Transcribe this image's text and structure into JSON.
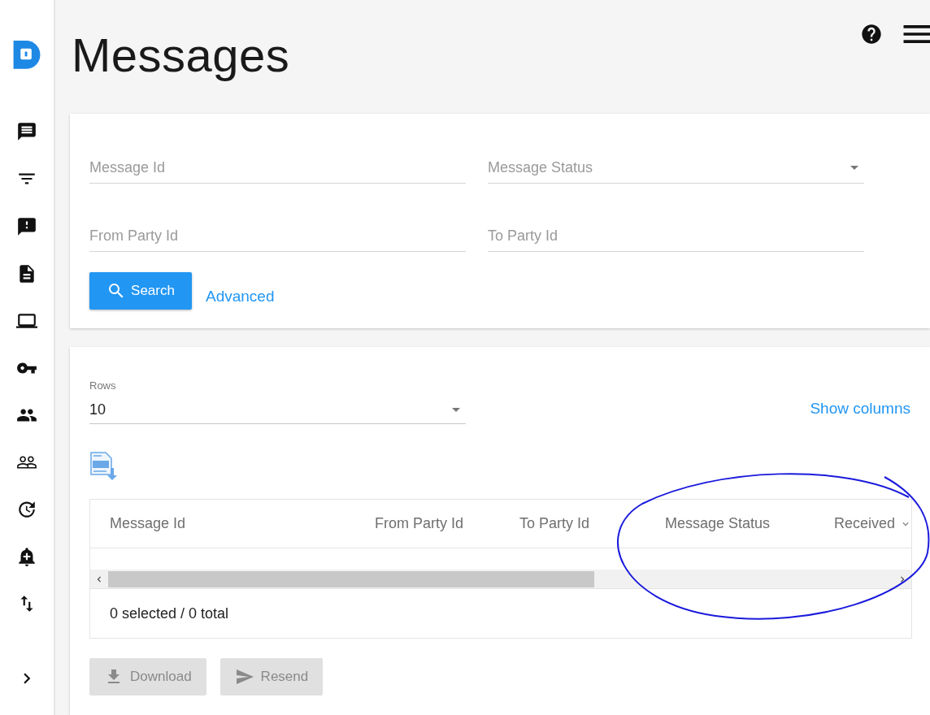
{
  "page": {
    "title": "Messages"
  },
  "filters": [
    {
      "kind": "text",
      "placeholder": "Message Id"
    },
    {
      "kind": "select",
      "placeholder": "Message Status"
    },
    {
      "kind": "text",
      "placeholder": "From Party Id"
    },
    {
      "kind": "text",
      "placeholder": "To Party Id"
    }
  ],
  "search_button": "Search",
  "advanced_link": "Advanced",
  "rows_select": {
    "label": "Rows",
    "value": "10"
  },
  "show_columns_link": "Show columns",
  "table": {
    "columns": [
      {
        "label": "Message Id"
      },
      {
        "label": "From Party Id"
      },
      {
        "label": "To Party Id"
      },
      {
        "label": "Message Status"
      },
      {
        "label": "Received"
      }
    ],
    "footer": "0 selected / 0 total"
  },
  "actions": [
    {
      "kind": "download",
      "label": "Download",
      "disabled": true
    },
    {
      "kind": "resend",
      "label": "Resend",
      "disabled": true
    }
  ]
}
